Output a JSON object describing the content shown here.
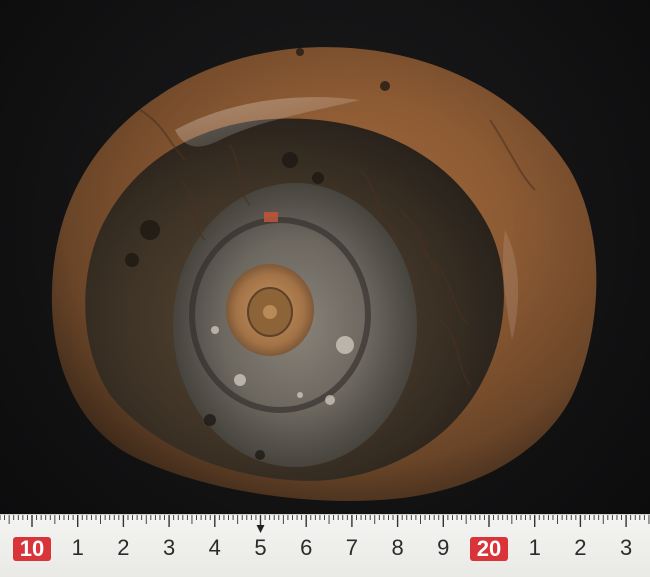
{
  "photo": {
    "subject_icon": "ammonite-fossil-icon",
    "background_color": "#141414"
  },
  "ruler": {
    "major_labels": [
      "10",
      "1",
      "2",
      "3",
      "4",
      "5",
      "6",
      "7",
      "8",
      "9",
      "20",
      "1",
      "2",
      "3"
    ],
    "highlight_labels": [
      "10",
      "20"
    ],
    "highlight_color": "#d9343a",
    "center_marker_label": "5"
  }
}
